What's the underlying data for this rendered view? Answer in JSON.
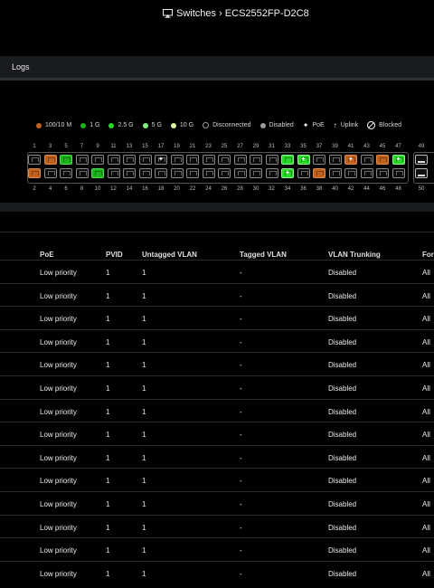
{
  "header": {
    "title": "Switches › ECS2552FP-D2C8",
    "icon": "monitor-icon"
  },
  "logs": {
    "label": "Logs"
  },
  "legend": [
    {
      "label": "100/10 M",
      "color": "#c0621d"
    },
    {
      "label": "1 G",
      "color": "#1bb31b"
    },
    {
      "label": "2.5 G",
      "color": "#27d627"
    },
    {
      "label": "5 G",
      "color": "#7ef07e"
    },
    {
      "label": "10 G",
      "color": "#d4f7a0"
    },
    {
      "label": "Disconnected"
    },
    {
      "label": "Disabled"
    },
    {
      "label": "PoE"
    },
    {
      "label": "Uplink"
    },
    {
      "label": "Blocked"
    }
  ],
  "ports": {
    "top_numbers": [
      "1",
      "3",
      "5",
      "7",
      "9",
      "11",
      "13",
      "15",
      "17",
      "19",
      "21",
      "23",
      "25",
      "27",
      "29",
      "31",
      "33",
      "35",
      "37",
      "39",
      "41",
      "43",
      "45",
      "47",
      "49"
    ],
    "bottom_numbers": [
      "2",
      "4",
      "6",
      "8",
      "10",
      "12",
      "14",
      "16",
      "18",
      "20",
      "22",
      "24",
      "26",
      "28",
      "30",
      "32",
      "34",
      "36",
      "38",
      "40",
      "42",
      "44",
      "46",
      "48",
      "50"
    ],
    "top_states": [
      "off",
      "orange",
      "green",
      "off",
      "off",
      "off",
      "off",
      "off",
      "off-poe",
      "off",
      "off",
      "off",
      "off",
      "off",
      "off",
      "off",
      "bright",
      "bright-poe",
      "off",
      "off",
      "orange-poe",
      "off",
      "orange",
      "bright-poe"
    ],
    "bottom_states": [
      "orange",
      "off",
      "off",
      "off",
      "green",
      "off",
      "off",
      "off",
      "off",
      "off",
      "off",
      "off",
      "off",
      "off",
      "off",
      "off",
      "bright-poe",
      "off",
      "orange",
      "off",
      "off",
      "off",
      "off",
      "off"
    ]
  },
  "table": {
    "headers": [
      "PoE",
      "PVID",
      "Untagged VLAN",
      "Tagged VLAN",
      "VLAN Trunking",
      "Forw"
    ],
    "rows": [
      [
        "Low priority",
        "1",
        "1",
        "-",
        "Disabled",
        "All"
      ],
      [
        "Low priority",
        "1",
        "1",
        "-",
        "Disabled",
        "All"
      ],
      [
        "Low priority",
        "1",
        "1",
        "-",
        "Disabled",
        "All"
      ],
      [
        "Low priority",
        "1",
        "1",
        "-",
        "Disabled",
        "All"
      ],
      [
        "Low priority",
        "1",
        "1",
        "-",
        "Disabled",
        "All"
      ],
      [
        "Low priority",
        "1",
        "1",
        "-",
        "Disabled",
        "All"
      ],
      [
        "Low priority",
        "1",
        "1",
        "-",
        "Disabled",
        "All"
      ],
      [
        "Low priority",
        "1",
        "1",
        "-",
        "Disabled",
        "All"
      ],
      [
        "Low priority",
        "1",
        "1",
        "-",
        "Disabled",
        "All"
      ],
      [
        "Low priority",
        "1",
        "1",
        "-",
        "Disabled",
        "All"
      ],
      [
        "Low priority",
        "1",
        "1",
        "-",
        "Disabled",
        "All"
      ],
      [
        "Low priority",
        "1",
        "1",
        "-",
        "Disabled",
        "All"
      ],
      [
        "Low priority",
        "1",
        "1",
        "-",
        "Disabled",
        "All"
      ],
      [
        "Low priority",
        "1",
        "1",
        "-",
        "Disabled",
        "All"
      ]
    ]
  }
}
